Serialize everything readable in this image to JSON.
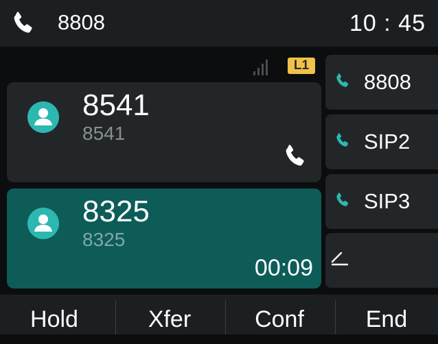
{
  "header": {
    "account": "8808",
    "time": "10 : 45",
    "phone_icon": "handset-icon"
  },
  "status": {
    "line_badge": "L1",
    "signal_icon": "signal-bars-icon",
    "badge_color": "#f0c24a"
  },
  "calls": [
    {
      "name": "8541",
      "number": "8541",
      "state_icon": "handset-icon",
      "duration": ""
    },
    {
      "name": "8325",
      "number": "8325",
      "duration": "00:09",
      "active": true,
      "active_color": "#0d5c58"
    }
  ],
  "line_keys": [
    {
      "label": "8808",
      "icon": "handset-icon"
    },
    {
      "label": "SIP2",
      "icon": "handset-icon"
    },
    {
      "label": "SIP3",
      "icon": "handset-icon"
    },
    {
      "label": "",
      "icon": "edit-icon"
    }
  ],
  "softkeys": [
    "Hold",
    "Xfer",
    "Conf",
    "End"
  ],
  "colors": {
    "accent": "#2cb8b0",
    "background": "#0b0d0e"
  }
}
